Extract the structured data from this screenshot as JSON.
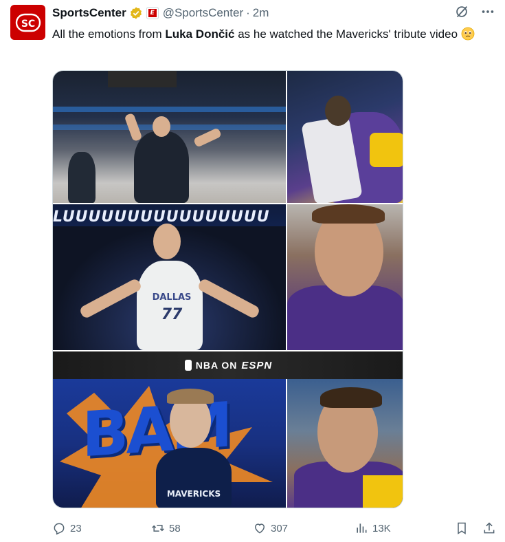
{
  "author": {
    "name": "SportsCenter",
    "handle": "@SportsCenter",
    "separator": "·",
    "time": "2m",
    "avatar_text": "SC",
    "affiliate_badge": "E"
  },
  "tweet": {
    "text_before": "All the emotions from ",
    "text_bold": "Luka Dončić",
    "text_after": " as he watched the Mavericks' tribute video",
    "emoji": "🥹"
  },
  "media": {
    "cell3_overlay": "LUUUUUUUUUUUUUUUU",
    "cell3_jersey_team": "DALLAS",
    "cell3_jersey_number": "77",
    "banner_left": "NBA ON",
    "banner_right": "ESPN",
    "cell6_word": "BAM",
    "cell6_jersey_team": "MAVERICKS"
  },
  "actions": {
    "replies": "23",
    "reposts": "58",
    "likes": "307",
    "views": "13K"
  },
  "icons": [
    "grok-icon",
    "more-icon",
    "reply-icon",
    "repost-icon",
    "like-icon",
    "views-icon",
    "bookmark-icon",
    "share-icon",
    "verified-icon"
  ],
  "colors": {
    "brand_red": "#cc0000",
    "verified_gold": "#e2b719",
    "meta_gray": "#536471",
    "text": "#0f1419"
  }
}
